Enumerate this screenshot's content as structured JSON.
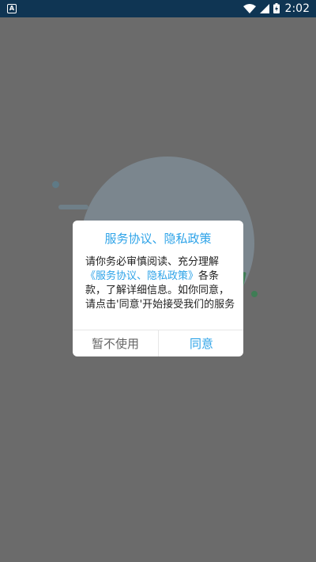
{
  "status_bar": {
    "app_icon_letter": "A",
    "time": "2:02",
    "icons": [
      "wifi-icon",
      "cell-signal-icon",
      "battery-icon"
    ]
  },
  "dialog": {
    "title": "服务协议、隐私政策",
    "body_prefix": "请你务必审慎阅读、充分理解",
    "body_link": "《服务协议、隐私政策》",
    "body_suffix": "各条款，了解详细信息。如你同意，请点击'同意'开始接受我们的服务",
    "decline_label": "暂不使用",
    "agree_label": "同意"
  },
  "colors": {
    "accent": "#2ea3e8",
    "overlay": "#6b6b6b",
    "status_bar": "#0f3553"
  }
}
